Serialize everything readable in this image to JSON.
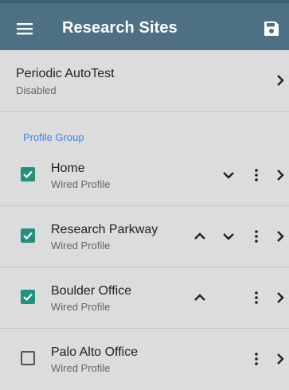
{
  "appbar": {
    "title": "Research Sites",
    "menu_icon": "hamburger-menu-icon",
    "save_icon": "floppy-disk-save-icon"
  },
  "autotest": {
    "title": "Periodic AutoTest",
    "subtitle": "Disabled"
  },
  "profile_group": {
    "label": "Profile Group",
    "items": [
      {
        "name": "Home",
        "type": "Wired Profile",
        "checked": true,
        "up": false,
        "down": true
      },
      {
        "name": "Research Parkway",
        "type": "Wired Profile",
        "checked": true,
        "up": true,
        "down": true
      },
      {
        "name": "Boulder Office",
        "type": "Wired Profile",
        "checked": true,
        "up": true,
        "down": false
      },
      {
        "name": "Palo Alto Office",
        "type": "Wired Profile",
        "checked": false,
        "up": false,
        "down": false
      }
    ]
  },
  "colors": {
    "appbar": "#4d7085",
    "accent_checkbox": "#21907f",
    "group_label": "#3a86e0",
    "background": "#dcdcdc"
  }
}
